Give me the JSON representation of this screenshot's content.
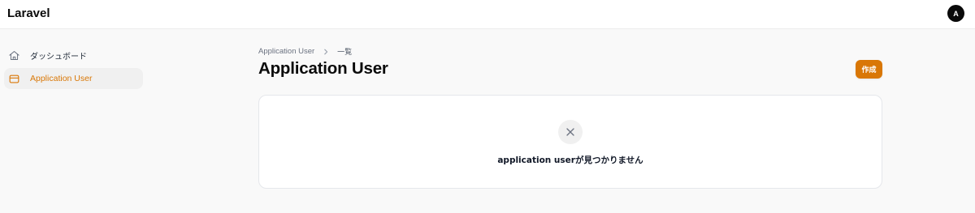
{
  "app": {
    "brand": "Laravel",
    "avatar_initial": "A"
  },
  "sidebar": {
    "items": [
      {
        "label": "ダッシュボード",
        "icon": "home-icon",
        "active": false
      },
      {
        "label": "Application User",
        "icon": "inbox-icon",
        "active": true
      }
    ]
  },
  "breadcrumb": {
    "parent": "Application User",
    "current": "一覧"
  },
  "page": {
    "title": "Application User",
    "create_label": "作成"
  },
  "empty_state": {
    "icon": "close-icon",
    "message": "application userが見つかりません"
  },
  "colors": {
    "accent": "#d97706",
    "background": "#f9f9f9",
    "panel": "#ffffff"
  }
}
